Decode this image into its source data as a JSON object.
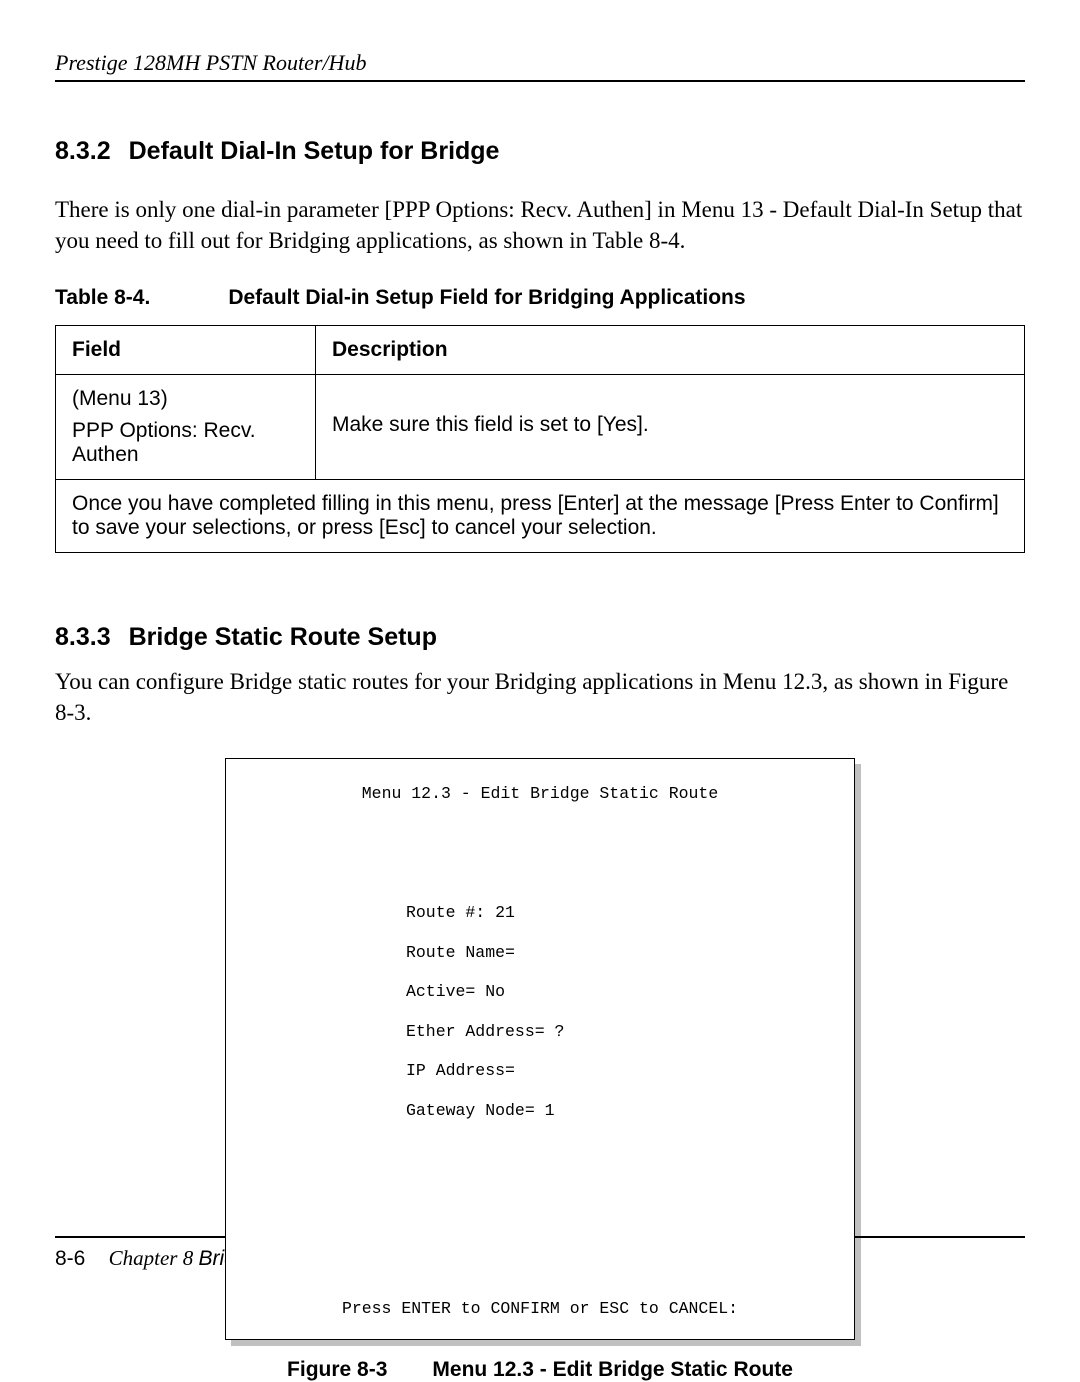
{
  "header": "Prestige 128MH    PSTN Router/Hub",
  "section1": {
    "number": "8.3.2",
    "title": "Default Dial-In Setup for Bridge",
    "body": "There is only one dial-in parameter [PPP Options: Recv. Authen] in Menu 13 - Default Dial-In Setup that you need to fill out for Bridging applications, as shown in Table 8-4."
  },
  "table": {
    "caption_number": "Table 8-4.",
    "caption_title": "Default Dial-in Setup Field for Bridging Applications",
    "headers": {
      "field": "Field",
      "description": "Description"
    },
    "row1": {
      "field_line1": "(Menu 13)",
      "field_line2": "PPP Options: Recv. Authen",
      "description": "Make sure this field is set to [Yes]."
    },
    "footer_note": "Once you have completed filling in this menu, press [Enter] at the message [Press Enter to Confirm] to save your selections, or press [Esc] to cancel your selection."
  },
  "section2": {
    "number": "8.3.3",
    "title": "Bridge Static Route Setup",
    "body": "You can configure Bridge static routes for your Bridging applications in Menu 12.3, as shown in Figure 8-3."
  },
  "terminal": {
    "title": "Menu 12.3 - Edit Bridge Static Route",
    "lines": {
      "l1": "Route #: 21",
      "l2": "Route Name=",
      "l3": "Active= No",
      "l4": "Ether Address= ?",
      "l5": "IP Address=",
      "l6": "Gateway Node= 1"
    },
    "footer": "Press ENTER to CONFIRM or ESC to CANCEL:"
  },
  "figure_caption": {
    "number": "Figure 8-3",
    "title": "Menu 12.3 - Edit Bridge Static Route"
  },
  "footer": {
    "page": "8-6",
    "chapter": "Chapter 8",
    "chapter_title": "Bridge Configuration for LAN-to-LAN"
  }
}
